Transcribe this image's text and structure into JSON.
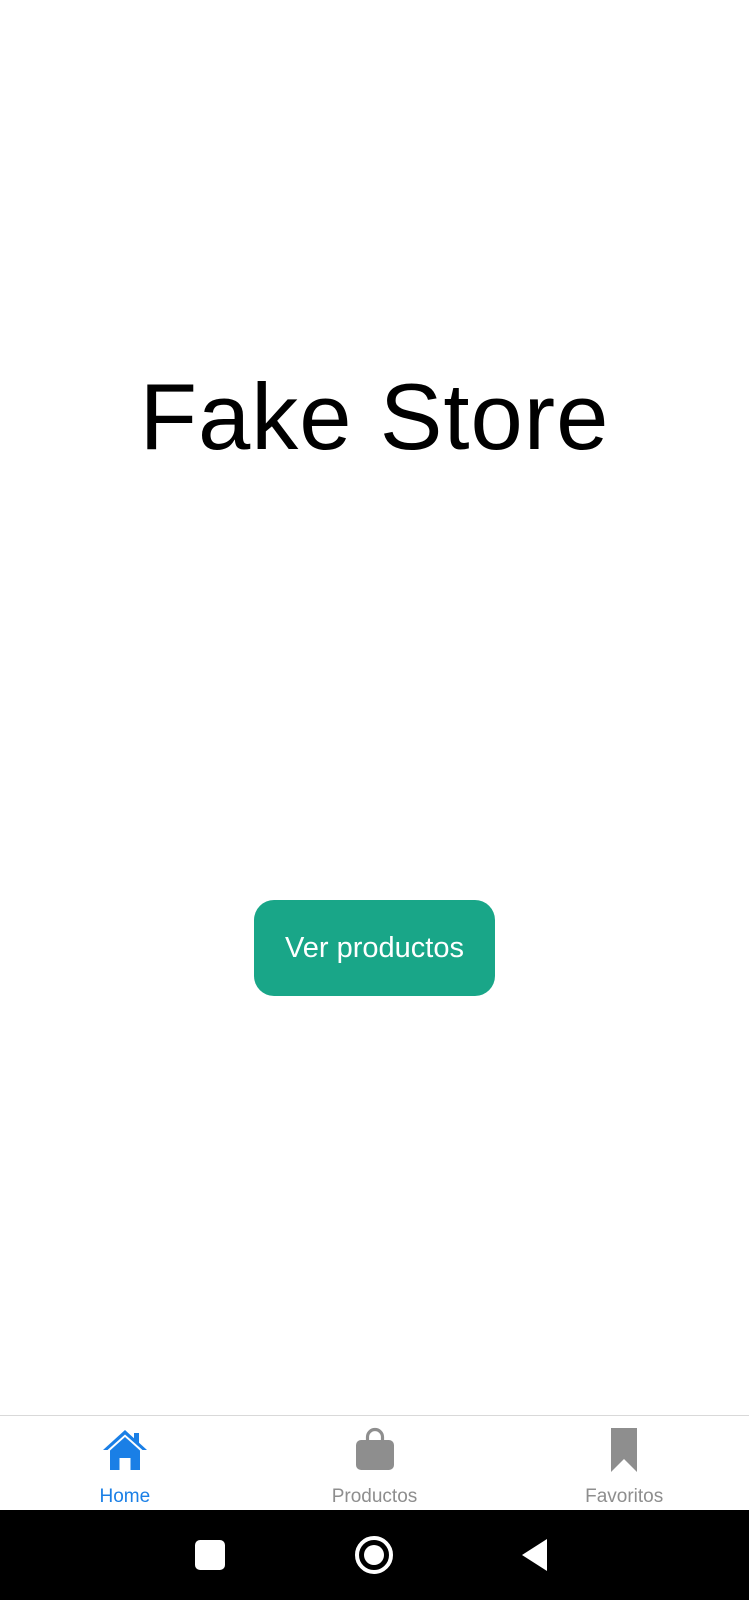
{
  "app": {
    "title": "Fake Store"
  },
  "main": {
    "cta_label": "Ver productos"
  },
  "tabbar": {
    "tabs": [
      {
        "label": "Home",
        "icon": "home-icon",
        "active": true
      },
      {
        "label": "Productos",
        "icon": "shopping-bag-icon",
        "active": false
      },
      {
        "label": "Favoritos",
        "icon": "bookmark-icon",
        "active": false
      }
    ]
  },
  "system_nav": {
    "buttons": [
      "recents-square-icon",
      "home-circle-icon",
      "back-triangle-icon"
    ]
  },
  "colors": {
    "accent": "#19a688",
    "tab_active": "#1a7fe6",
    "tab_inactive": "#8e8e8e",
    "system_nav_bg": "#000000"
  }
}
